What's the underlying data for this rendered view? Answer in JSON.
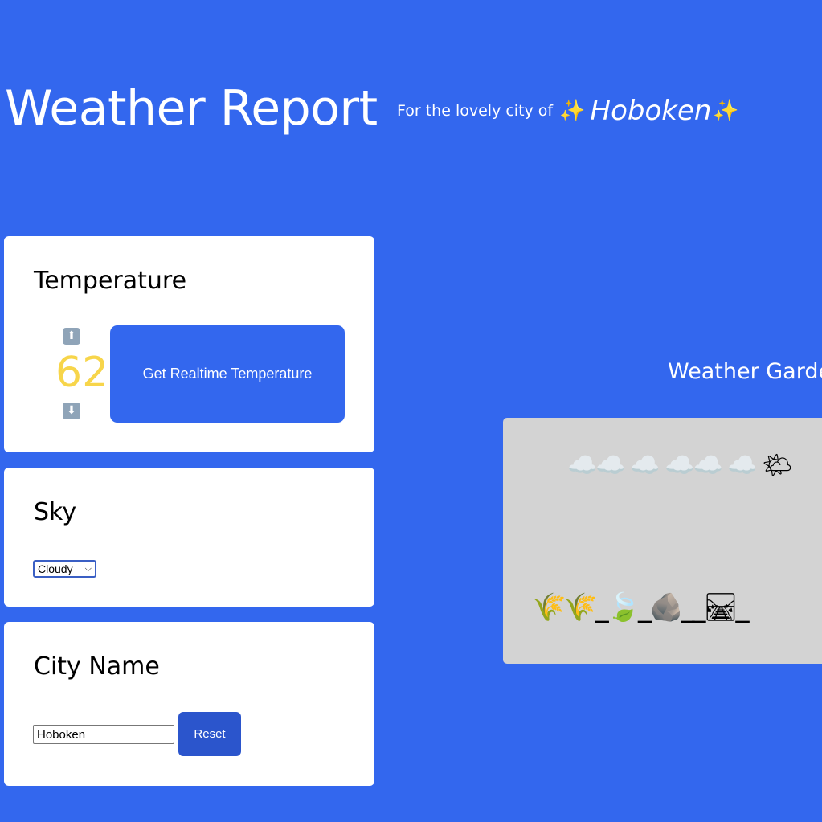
{
  "header": {
    "title": "Weather Report",
    "subtitle_prefix": "For the lovely city of",
    "sparkle_left": "✨",
    "city": "Hoboken",
    "sparkle_right": "✨"
  },
  "temperature": {
    "heading": "Temperature",
    "value": "62",
    "up_arrow": "⬆",
    "down_arrow": "⬇",
    "realtime_button": "Get Realtime Temperature",
    "value_color": "#f7d54a"
  },
  "sky": {
    "heading": "Sky",
    "selected": "Cloudy",
    "chevron": "⌵"
  },
  "city_name": {
    "heading": "City Name",
    "input_value": "Hoboken",
    "reset_button": "Reset"
  },
  "garden": {
    "heading": "Weather Garden",
    "sky_emojis": "☁️☁️ ☁️ ☁️☁️ ☁️ 🌤",
    "landscape_emojis": "🌾🌾_🍃_🪨__🛤_"
  },
  "colors": {
    "background": "#3367ee",
    "card": "#ffffff",
    "garden_bg": "#d3d3d3",
    "button": "#3367ee",
    "reset_button": "#2b55cc"
  }
}
